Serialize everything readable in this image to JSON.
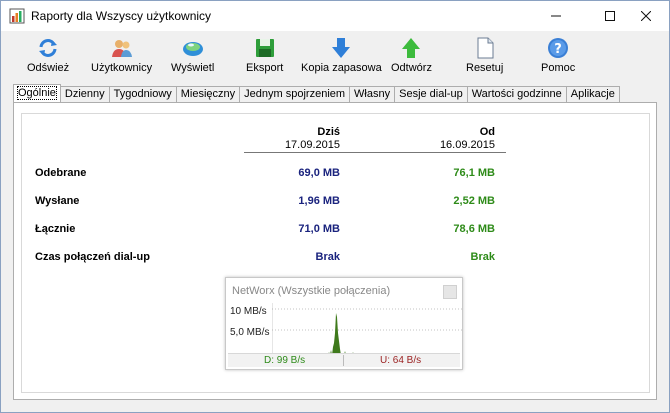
{
  "window": {
    "title": "Raporty dla Wszyscy użytkownicy",
    "controls": {
      "minimize": "—",
      "maximize": "☐",
      "close": "✕"
    }
  },
  "toolbar": {
    "refresh": "Odśwież",
    "users": "Użytkownicy",
    "display": "Wyświetl",
    "export": "Eksport",
    "backup": "Kopia zapasowa",
    "restore": "Odtwórz",
    "reset": "Resetuj",
    "help": "Pomoc"
  },
  "tabs": [
    "Ogólnie",
    "Dzienny",
    "Tygodniowy",
    "Miesięczny",
    "Jednym spojrzeniem",
    "Własny",
    "Sesje dial-up",
    "Wartości godzinne",
    "Aplikacje"
  ],
  "summary": {
    "col_today": "Dziś",
    "col_today_date": "17.09.2015",
    "col_since": "Od",
    "col_since_date": "16.09.2015",
    "rows": [
      {
        "label": "Odebrane",
        "today": "69,0 MB",
        "since": "76,1 MB"
      },
      {
        "label": "Wysłane",
        "today": "1,96 MB",
        "since": "2,52 MB"
      },
      {
        "label": "Łącznie",
        "today": "71,0 MB",
        "since": "78,6 MB"
      },
      {
        "label": "Czas połączeń dial-up",
        "today": "Brak",
        "since": "Brak"
      }
    ]
  },
  "networx": {
    "title": "NetWorx (Wszystkie połączenia)",
    "y_top": "10 MB/s",
    "y_mid": "5,0 MB/s",
    "download": "D: 99 B/s",
    "upload": "U: 64 B/s",
    "colors": {
      "download": "#2e8b19",
      "upload": "#9a1f1f",
      "graph": "#3f7a1c"
    }
  }
}
